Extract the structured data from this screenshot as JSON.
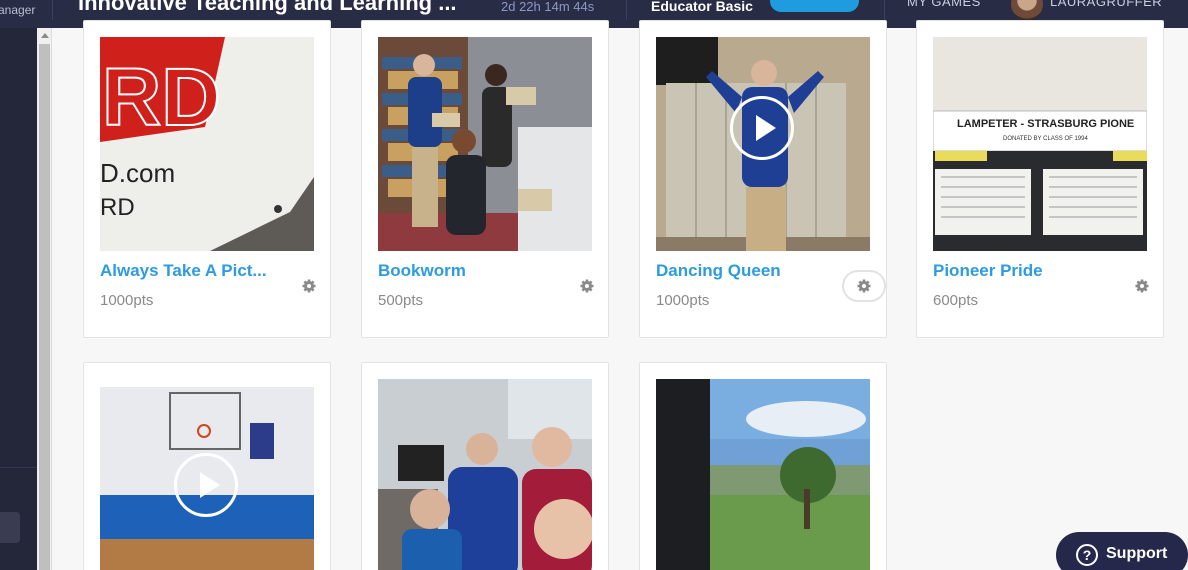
{
  "header": {
    "manager_label": "anager",
    "game_title": "Innovative Teaching and Learning ...",
    "countdown": "2d 22h 14m 44s",
    "plan": "Educator Basic",
    "my_games": "MY GAMES",
    "username": "LAURAGRUFFER"
  },
  "missions": [
    {
      "title": "Always Take A Pict...",
      "points": "1000pts",
      "media": "photo"
    },
    {
      "title": "Bookworm",
      "points": "500pts",
      "media": "photo"
    },
    {
      "title": "Dancing Queen",
      "points": "1000pts",
      "media": "video"
    },
    {
      "title": "Pioneer Pride",
      "points": "600pts",
      "media": "photo"
    },
    {
      "title": "",
      "points": "",
      "media": "video"
    },
    {
      "title": "",
      "points": "",
      "media": "photo"
    },
    {
      "title": "",
      "points": "",
      "media": "photo"
    }
  ],
  "thumbnail_text": {
    "banner_big": "RD",
    "banner_url": "D.com",
    "banner_small": "RD",
    "sign": "LAMPETER - STRASBURG PIONE",
    "sign_sub": "DONATED BY CLASS OF 1994"
  },
  "support": {
    "label": "Support",
    "icon": "question-circle-icon"
  },
  "colors": {
    "topbar": "#282c45",
    "accent": "#2d9be0",
    "support": "#25284a"
  }
}
